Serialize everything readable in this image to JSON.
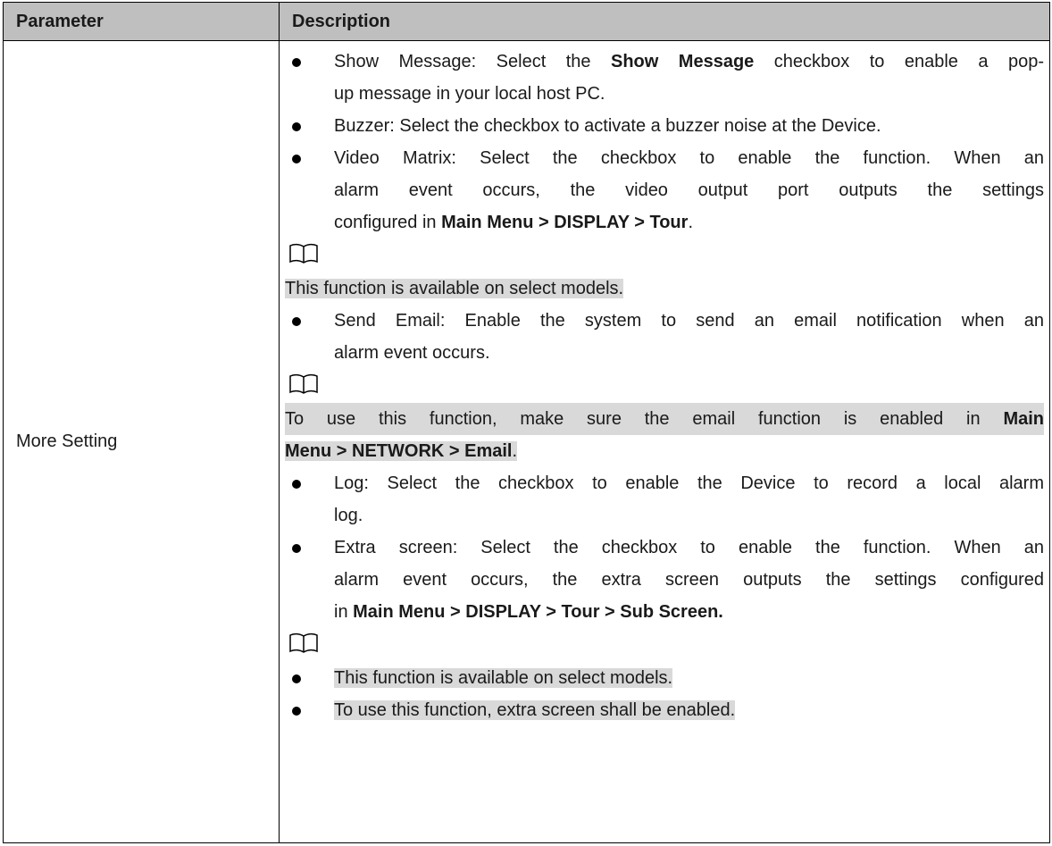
{
  "table": {
    "header": {
      "col1": "Parameter",
      "col2": "Description"
    },
    "row": {
      "parameter": "More Setting",
      "show_message": {
        "p1": "Show Message: Select the ",
        "b1": "Show Message",
        "p2": " checkbox to enable a pop-",
        "line2": "up message in your local host PC."
      },
      "buzzer": "Buzzer: Select the checkbox to activate a buzzer noise at the Device.",
      "video_matrix": {
        "line1": "Video Matrix: Select the checkbox to enable the function. When an",
        "line2": "alarm event occurs, the video output port outputs the settings",
        "p1": "configured in ",
        "b1": "Main Menu > DISPLAY > Tour",
        "p2": "."
      },
      "note1": "This function is available on select models.",
      "send_email": {
        "line1": "Send Email: Enable the system to send an email notification when an",
        "line2": "alarm event occurs."
      },
      "note2": {
        "line1_p1": "To use this function, make sure the email function is enabled in ",
        "line1_b1": "Main",
        "line2_b1": "Menu > NETWORK > Email",
        "line2_p2": "."
      },
      "log": {
        "line1": "Log: Select the checkbox to enable the Device to record a local alarm",
        "line2": "log."
      },
      "extra_screen": {
        "line1": "Extra screen: Select the checkbox to enable the function. When an",
        "line2": "alarm event occurs, the extra screen outputs the settings configured",
        "p1": "in ",
        "b1": "Main Menu > DISPLAY > Tour > Sub Screen."
      },
      "note3": [
        "This function is available on select models.",
        "To use this function, extra screen shall be enabled."
      ]
    }
  },
  "icons": {
    "note": "book-icon"
  }
}
